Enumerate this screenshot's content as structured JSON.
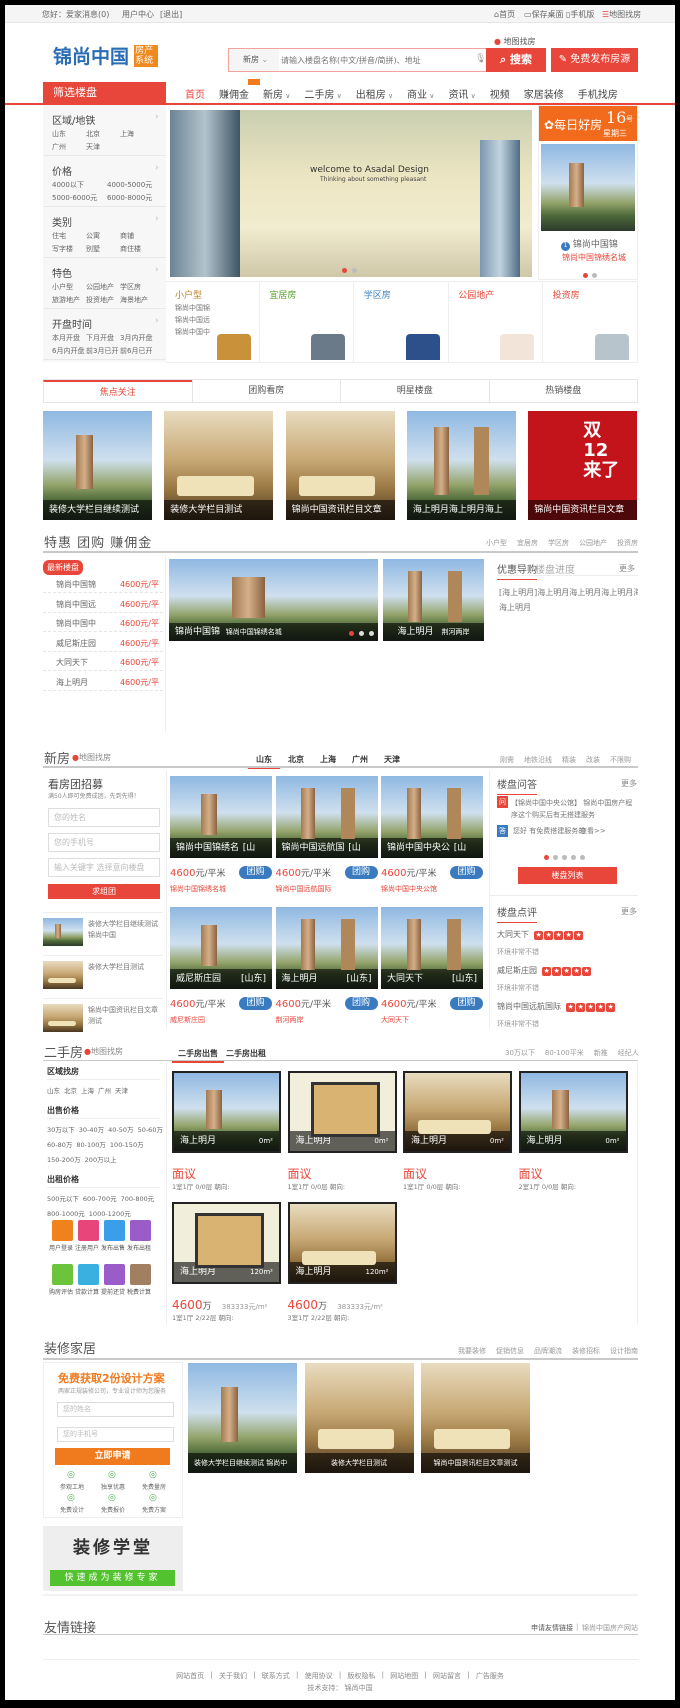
{
  "topbar": {
    "greeting": "您好：爱家",
    "messages": "消息(0)",
    "user_center": "用户中心",
    "logout": "[退出]",
    "home": "首页",
    "save_desktop": "保存桌面",
    "mobile": "手机版",
    "map_search": "地图找房"
  },
  "header": {
    "logo_text": "锦尚中国",
    "logo_badge": "房产系统",
    "map_link": "地图找房",
    "search_type": "新房",
    "search_placeholder": "请输入楼盘名称(中文/拼音/简拼)、地址",
    "search_button": "搜索",
    "publish_button": "免费发布房源"
  },
  "nav": {
    "filter_title": "筛选楼盘",
    "items": [
      "首页",
      "赚佣金",
      "新房",
      "二手房",
      "出租房",
      "商业",
      "资讯",
      "视频",
      "家居装修",
      "手机找房"
    ],
    "dropdown": [
      false,
      false,
      true,
      true,
      true,
      true,
      true,
      false,
      false,
      false
    ]
  },
  "sidebar": [
    {
      "title": "区域/地铁",
      "cols": 3,
      "links": [
        "山东",
        "北京",
        "上海",
        "广州",
        "天津"
      ]
    },
    {
      "title": "价格",
      "cols": 2,
      "links": [
        "4000以下",
        "4000-5000元",
        "5000-6000元",
        "6000-8000元"
      ]
    },
    {
      "title": "类别",
      "cols": 3,
      "links": [
        "住宅",
        "公寓",
        "商铺",
        "写字楼",
        "别墅",
        "商住楼"
      ]
    },
    {
      "title": "特色",
      "cols": 3,
      "links": [
        "小户型",
        "公园地产",
        "学区房",
        "旅游地产",
        "投资地产",
        "海景地产"
      ]
    },
    {
      "title": "开盘时间",
      "cols": 3,
      "links": [
        "本月开盘",
        "下月开盘",
        "3月内开盘",
        "6月内开盘",
        "前3月已开",
        "前6月已开"
      ]
    }
  ],
  "banner": {
    "title": "welcome to Asadal Design",
    "subtitle": "Thinking about something pleasant"
  },
  "daily": {
    "title": "每日好房",
    "day": "16",
    "day_unit": "号",
    "weekday": "星期三",
    "name": "锦尚中国锦",
    "subtitle": "锦尚中国锦绣名城"
  },
  "categories": [
    {
      "title": "小户型",
      "color": "#b8862b",
      "items": [
        "锦尚中国锦",
        "锦尚中国远",
        "锦尚中国中"
      ]
    },
    {
      "title": "宜居房",
      "color": "#5aa02c",
      "items": []
    },
    {
      "title": "学区房",
      "color": "#3a7fc4",
      "items": []
    },
    {
      "title": "公园地产",
      "color": "#e8463a",
      "items": []
    },
    {
      "title": "投资房",
      "color": "#e8463a",
      "items": []
    }
  ],
  "focus": {
    "tabs": [
      "焦点关注",
      "团购看房",
      "明星楼盘",
      "热销楼盘"
    ],
    "items": [
      "装修大学栏目继续测试",
      "装修大学栏目测试",
      "锦尚中国资讯栏目文章",
      "海上明月海上明月海上",
      "锦尚中国资讯栏目文章"
    ]
  },
  "deals": {
    "title": "特惠 团购 赚佣金",
    "filters": [
      "小户型",
      "宜居房",
      "学区房",
      "公园地产",
      "投资房"
    ],
    "badge": "最新楼盘",
    "list": [
      {
        "name": "锦尚中国锦",
        "price": "4600元/平"
      },
      {
        "name": "锦尚中国远",
        "price": "4600元/平"
      },
      {
        "name": "锦尚中国中",
        "price": "4600元/平"
      },
      {
        "name": "威尼斯庄园",
        "price": "4600元/平"
      },
      {
        "name": "大同天下",
        "price": "4600元/平"
      },
      {
        "name": "海上明月",
        "price": "4600元/平"
      }
    ],
    "slide_name": "锦尚中国锦",
    "slide_sub": "锦尚中国锦绣名城",
    "side_name": "海上明月",
    "side_sub": "荆河两岸",
    "guide_tabs": [
      "优惠导购",
      "楼盘进度"
    ],
    "more": "更多",
    "guide_text": "[海上明月]海上明月海上明月海上明月海上明",
    "guide_text2": "海上明月"
  },
  "newhomes": {
    "title": "新房",
    "map": "地图找房",
    "cities": [
      "山东",
      "北京",
      "上海",
      "广州",
      "天津"
    ],
    "filters": [
      "刚需",
      "地铁沿线",
      "精装",
      "改装",
      "不限购"
    ],
    "recruit_title": "看房团招募",
    "recruit_sub": "满50人即可免费成团，先到先得！",
    "name_ph": "您的姓名",
    "phone_ph": "您的手机号",
    "kw_ph": "输入关键字 选择意向楼盘",
    "join": "求组团",
    "articles": [
      "装修大学栏目继续测试 锦尚中国",
      "装修大学栏目测试",
      "锦尚中国资讯栏目文章测试"
    ],
    "cards": [
      {
        "name": "锦尚中国锦绣名城",
        "region": "[山东]",
        "price": "4600",
        "unit": "元/平米",
        "btn": "团购",
        "link": "锦尚中国锦绣名城"
      },
      {
        "name": "锦尚中国远航国际",
        "region": "[山东]",
        "price": "4600",
        "unit": "元/平米",
        "btn": "团购",
        "link": "锦尚中国远航国际"
      },
      {
        "name": "锦尚中国中央公馆",
        "region": "[山东]",
        "price": "4600",
        "unit": "元/平米",
        "btn": "团购",
        "link": "锦尚中国中央公馆"
      },
      {
        "name": "威尼斯庄园",
        "region": "[山东]",
        "price": "4600",
        "unit": "元/平米",
        "btn": "团购",
        "link": "威尼斯庄园"
      },
      {
        "name": "海上明月",
        "region": "[山东]",
        "price": "4600",
        "unit": "元/平米",
        "btn": "团购",
        "link": "荆河两岸"
      },
      {
        "name": "大同天下",
        "region": "[山东]",
        "price": "4600",
        "unit": "元/平米",
        "btn": "团购",
        "link": "大同天下"
      }
    ]
  },
  "qa": {
    "title": "楼盘问答",
    "more": "更多",
    "q_tag": "问",
    "question": "【锦尚中国中央公馆】 锦尚中国房产程序这个购买后有无搭建服务",
    "a_tag": "答",
    "answer": "您好 有免费搭建服务的",
    "view": "查看>>",
    "button": "楼盘列表"
  },
  "reviews": {
    "title": "楼盘点评",
    "more": "更多",
    "items": [
      {
        "name": "大同天下",
        "text": "环境非常不错",
        "stars": 5
      },
      {
        "name": "威尼斯庄园",
        "text": "环境非常不错",
        "stars": 5
      },
      {
        "name": "锦尚中国远航国际",
        "text": "环境非常不错",
        "stars": 5
      }
    ]
  },
  "secondhand": {
    "title": "二手房",
    "map": "地图找房",
    "tabs": [
      "二手房出售",
      "二手房出租"
    ],
    "filters": [
      "30万以下",
      "80-100平米",
      "新推",
      "经纪人"
    ],
    "groups": [
      {
        "title": "区域找房",
        "rows": [
          [
            "山东",
            "北京",
            "上海",
            "广州",
            "天津"
          ]
        ]
      },
      {
        "title": "出售价格",
        "rows": [
          [
            "30万以下",
            "30-40万",
            "40-50万",
            "50-60万"
          ],
          [
            "60-80万",
            "80-100万",
            "100-150万"
          ],
          [
            "150-200万",
            "200万以上"
          ]
        ]
      },
      {
        "title": "出租价格",
        "rows": [
          [
            "500元以下",
            "600-700元",
            "700-800元"
          ],
          [
            "800-1000元",
            "1000-1200元"
          ]
        ]
      }
    ],
    "tools": [
      {
        "label": "用户登录",
        "color": "#f0821e"
      },
      {
        "label": "注册用户",
        "color": "#e8467a"
      },
      {
        "label": "发布出售",
        "color": "#3a9ee8"
      },
      {
        "label": "发布出租",
        "color": "#9a5cc8"
      },
      {
        "label": "购房评估",
        "color": "#6cc43c"
      },
      {
        "label": "贷款计算",
        "color": "#3ab0e0"
      },
      {
        "label": "提前还贷",
        "color": "#9a5cc8"
      },
      {
        "label": "税费计算",
        "color": "#a08060"
      }
    ],
    "cards": [
      {
        "name": "海上明月",
        "area": "0m²",
        "price": "面议",
        "unit": "",
        "unit_price": "",
        "info": "1室1厅 0/0层 朝向:"
      },
      {
        "name": "海上明月",
        "area": "0m²",
        "price": "面议",
        "unit": "",
        "unit_price": "",
        "info": "1室1厅 0/0层 朝向:"
      },
      {
        "name": "海上明月",
        "area": "0m²",
        "price": "面议",
        "unit": "",
        "unit_price": "",
        "info": "1室1厅 0/0层 朝向:"
      },
      {
        "name": "海上明月",
        "area": "0m²",
        "price": "面议",
        "unit": "",
        "unit_price": "",
        "info": "2室1厅 0/0层 朝向:"
      },
      {
        "name": "海上明月",
        "area": "120m²",
        "price": "4600",
        "unit": "万",
        "unit_price": "383333元/m²",
        "info": "1室1厅 2/22层 朝向:"
      },
      {
        "name": "海上明月",
        "area": "120m²",
        "price": "4600",
        "unit": "万",
        "unit_price": "383333元/m²",
        "info": "3室1厅 2/22层 朝向:"
      }
    ]
  },
  "decor": {
    "title": "装修家居",
    "links": [
      "我要装修",
      "促销信息",
      "品牌潮流",
      "装修招标",
      "设计指南"
    ],
    "form_title": "免费获取2份设计方案",
    "form_sub": "两家正规装修公司，专业设计师为您服务",
    "name_ph": "您的姓名",
    "phone_ph": "您的手机号",
    "button": "立即申请",
    "services": [
      "参观工地",
      "独享优惠",
      "免费量房",
      "免费设计",
      "免费报价",
      "免费方案"
    ],
    "images": [
      "装修大学栏目继续测试 锦尚中国",
      "装修大学栏目测试",
      "锦尚中国资讯栏目文章测试"
    ],
    "school": "装修学堂",
    "school_sub": "快速成为装修专家"
  },
  "friend_links": {
    "title": "友情链接",
    "apply": "申请友情链接",
    "site": "锦尚中国房产网站"
  },
  "footer": {
    "links": [
      "网站首页",
      "关于我们",
      "联系方式",
      "使用协议",
      "版权隐私",
      "网站地图",
      "网站留言",
      "广告服务"
    ],
    "tech": "技术支持： 锦尚中国"
  }
}
